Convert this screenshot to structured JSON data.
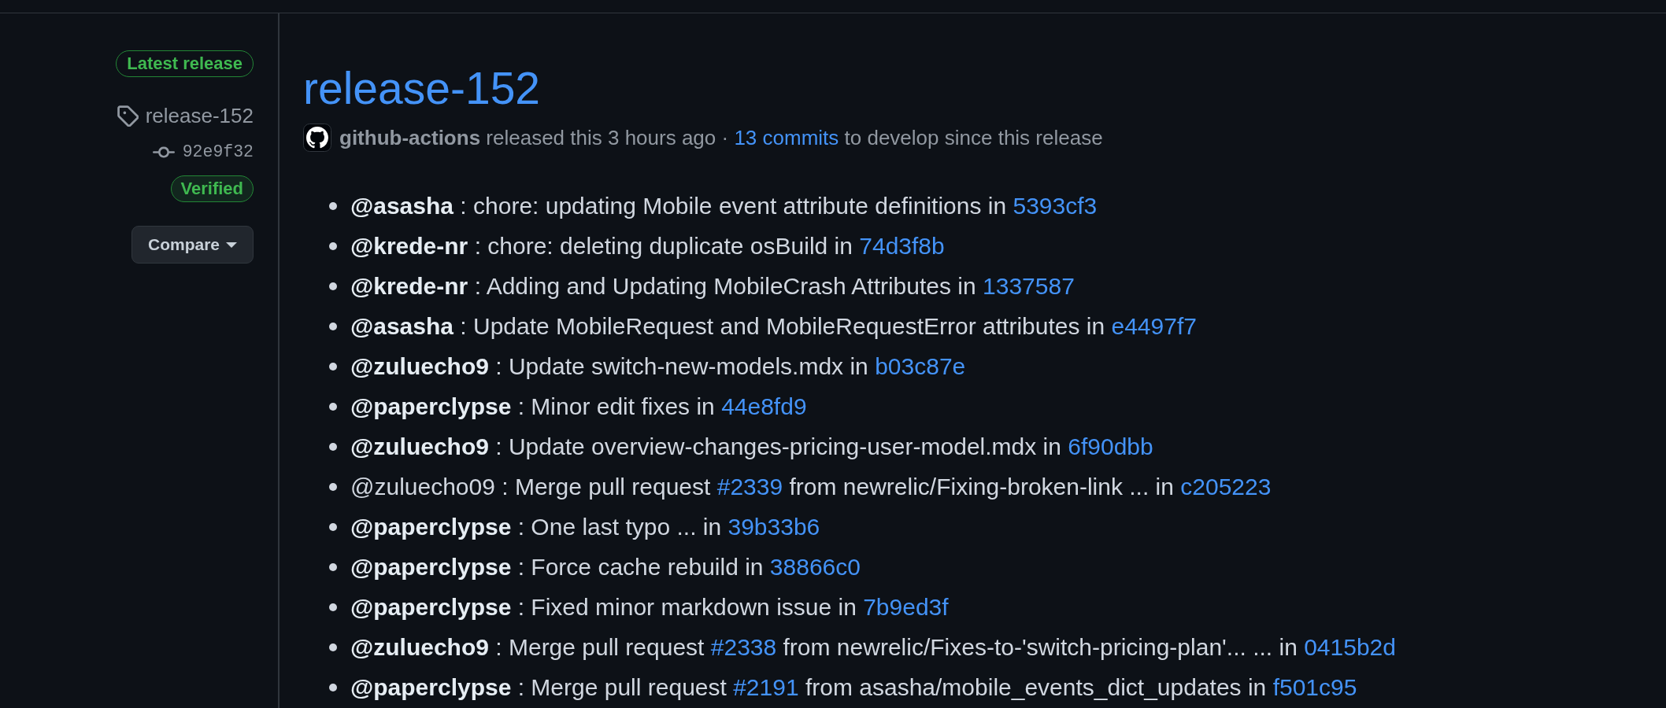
{
  "sidebar": {
    "latest_badge": "Latest release",
    "tag": "release-152",
    "commit": "92e9f32",
    "verified_badge": "Verified",
    "compare_button": "Compare"
  },
  "release": {
    "title": "release-152",
    "meta": [
      {
        "kind": "author",
        "text": "github-actions"
      },
      {
        "kind": "text",
        "text": " released this 3 hours ago · "
      },
      {
        "kind": "link",
        "text": "13 commits"
      },
      {
        "kind": "text",
        "text": " to develop since this release"
      }
    ],
    "notes": [
      {
        "parts": [
          {
            "kind": "mention",
            "text": "@asasha"
          },
          {
            "kind": "text",
            "text": " : chore: updating Mobile event attribute definitions in "
          },
          {
            "kind": "commit",
            "text": "5393cf3"
          }
        ]
      },
      {
        "parts": [
          {
            "kind": "mention",
            "text": "@krede-nr"
          },
          {
            "kind": "text",
            "text": " : chore: deleting duplicate osBuild in "
          },
          {
            "kind": "commit",
            "text": "74d3f8b"
          }
        ]
      },
      {
        "parts": [
          {
            "kind": "mention",
            "text": "@krede-nr"
          },
          {
            "kind": "text",
            "text": " : Adding and Updating MobileCrash Attributes in "
          },
          {
            "kind": "commit",
            "text": "1337587"
          }
        ]
      },
      {
        "parts": [
          {
            "kind": "mention",
            "text": "@asasha"
          },
          {
            "kind": "text",
            "text": " : Update MobileRequest and MobileRequestError attributes in "
          },
          {
            "kind": "commit",
            "text": "e4497f7"
          }
        ]
      },
      {
        "parts": [
          {
            "kind": "mention",
            "text": "@zuluecho9"
          },
          {
            "kind": "text",
            "text": " : Update switch-new-models.mdx in "
          },
          {
            "kind": "commit",
            "text": "b03c87e"
          }
        ]
      },
      {
        "parts": [
          {
            "kind": "mention",
            "text": "@paperclypse"
          },
          {
            "kind": "text",
            "text": " : Minor edit fixes in "
          },
          {
            "kind": "commit",
            "text": "44e8fd9"
          }
        ]
      },
      {
        "parts": [
          {
            "kind": "mention",
            "text": "@zuluecho9"
          },
          {
            "kind": "text",
            "text": " : Update overview-changes-pricing-user-model.mdx in "
          },
          {
            "kind": "commit",
            "text": "6f90dbb"
          }
        ]
      },
      {
        "parts": [
          {
            "kind": "text",
            "text": "@zuluecho09 : Merge pull request "
          },
          {
            "kind": "issue",
            "text": "#2339"
          },
          {
            "kind": "text",
            "text": " from newrelic/Fixing-broken-link ... in "
          },
          {
            "kind": "commit",
            "text": "c205223"
          }
        ]
      },
      {
        "parts": [
          {
            "kind": "mention",
            "text": "@paperclypse"
          },
          {
            "kind": "text",
            "text": " : One last typo ... in "
          },
          {
            "kind": "commit",
            "text": "39b33b6"
          }
        ]
      },
      {
        "parts": [
          {
            "kind": "mention",
            "text": "@paperclypse"
          },
          {
            "kind": "text",
            "text": " : Force cache rebuild in "
          },
          {
            "kind": "commit",
            "text": "38866c0"
          }
        ]
      },
      {
        "parts": [
          {
            "kind": "mention",
            "text": "@paperclypse"
          },
          {
            "kind": "text",
            "text": " : Fixed minor markdown issue in "
          },
          {
            "kind": "commit",
            "text": "7b9ed3f"
          }
        ]
      },
      {
        "parts": [
          {
            "kind": "mention",
            "text": "@zuluecho9"
          },
          {
            "kind": "text",
            "text": " : Merge pull request "
          },
          {
            "kind": "issue",
            "text": "#2338"
          },
          {
            "kind": "text",
            "text": " from newrelic/Fixes-to-'switch-pricing-plan'... ... in "
          },
          {
            "kind": "commit",
            "text": "0415b2d"
          }
        ]
      },
      {
        "parts": [
          {
            "kind": "mention",
            "text": "@paperclypse"
          },
          {
            "kind": "text",
            "text": " : Merge pull request "
          },
          {
            "kind": "issue",
            "text": "#2191"
          },
          {
            "kind": "text",
            "text": " from asasha/mobile_events_dict_updates in "
          },
          {
            "kind": "commit",
            "text": "f501c95"
          }
        ]
      }
    ]
  }
}
